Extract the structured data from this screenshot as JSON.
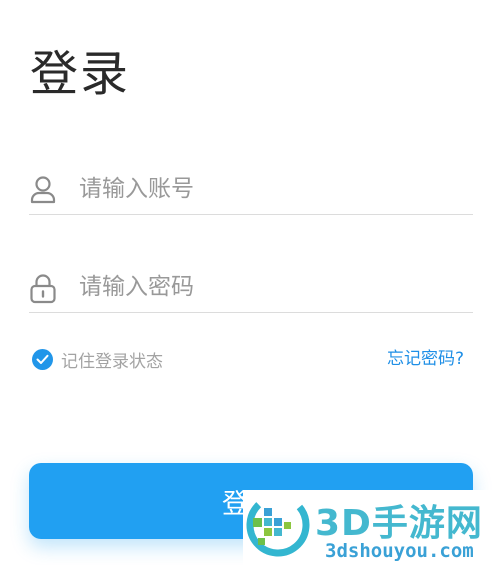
{
  "page": {
    "title": "登录"
  },
  "form": {
    "username": {
      "placeholder": "请输入账号",
      "value": "",
      "icon": "user-icon"
    },
    "password": {
      "placeholder": "请输入密码",
      "value": "",
      "icon": "lock-icon"
    },
    "remember": {
      "label": "记住登录状态",
      "checked": true,
      "icon": "checkmark-icon"
    },
    "forgot_label": "忘记密码?",
    "submit_label": "登录"
  },
  "watermark": {
    "brand": "3D手游网",
    "site": "3dshouyou.com"
  },
  "colors": {
    "accent": "#21a0f2",
    "link": "#1f8fe6",
    "placeholder": "#999999",
    "divider": "#dcdcdc"
  }
}
